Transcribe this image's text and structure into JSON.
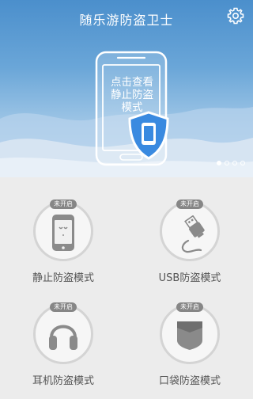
{
  "app": {
    "title": "随乐游防盗卫士"
  },
  "header": {
    "settings_icon": "gear-icon"
  },
  "banner": {
    "lines": [
      "点击查看",
      "静止防盗",
      "模式"
    ],
    "dots": 4,
    "active_dot": 0,
    "colors": {
      "accent": "#4a8fd0",
      "shield": "#3a8ae0"
    }
  },
  "modes": [
    {
      "label": "静止防盗模式",
      "status": "未开启",
      "icon": "phone-sleep-icon"
    },
    {
      "label": "USB防盗模式",
      "status": "未开启",
      "icon": "usb-cable-icon"
    },
    {
      "label": "耳机防盗模式",
      "status": "未开启",
      "icon": "headphones-icon"
    },
    {
      "label": "口袋防盗模式",
      "status": "未开启",
      "icon": "pocket-icon"
    }
  ]
}
